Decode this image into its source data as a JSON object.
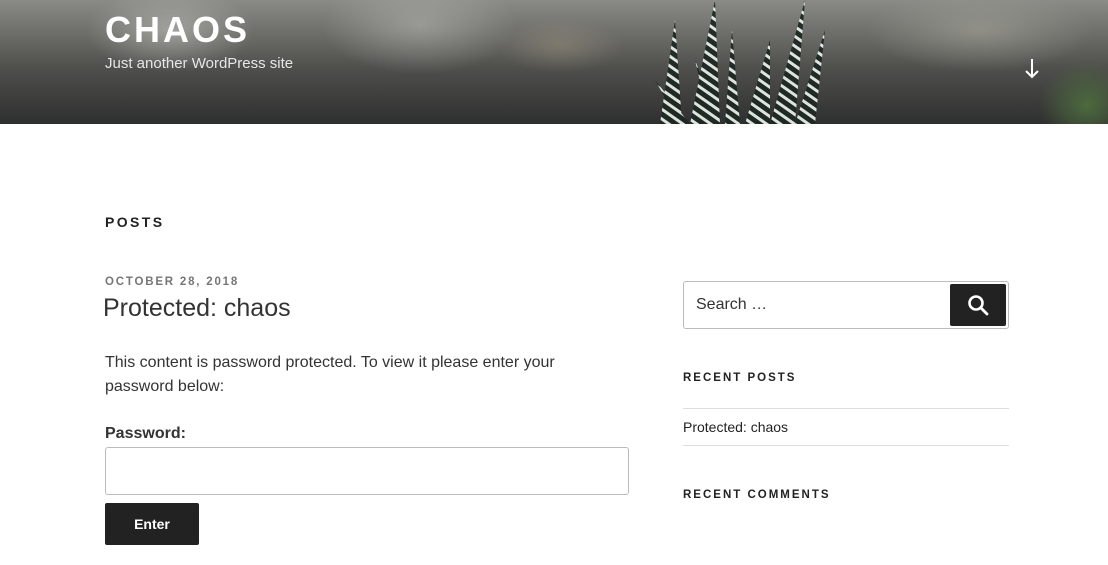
{
  "header": {
    "site_title": "CHAOS",
    "site_description": "Just another WordPress site",
    "scroll_icon": "arrow-down-icon"
  },
  "page": {
    "title": "POSTS"
  },
  "post": {
    "date": "OCTOBER 28, 2018",
    "title": "Protected: chaos",
    "text": "This content is password protected. To view it please enter your password below:",
    "password_label": "Password:",
    "password_value": "",
    "submit_label": "Enter"
  },
  "sidebar": {
    "search_placeholder": "Search …",
    "search_icon": "search-icon",
    "recent_posts_title": "RECENT POSTS",
    "recent_posts": [
      "Protected: chaos"
    ],
    "recent_comments_title": "RECENT COMMENTS"
  },
  "colors": {
    "button": "#222222",
    "meta": "#767676",
    "border": "#bbbbbb"
  }
}
